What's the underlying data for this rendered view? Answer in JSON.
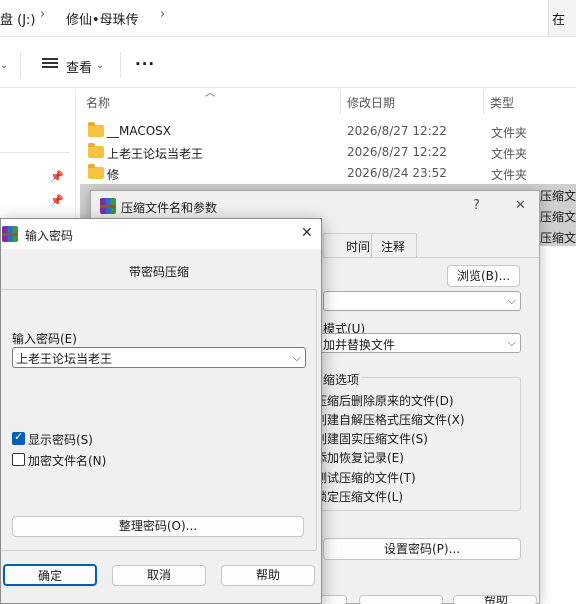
{
  "explorer": {
    "breadcrumb": {
      "drive": "盘 (J:)",
      "folder": "修仙•母珠传",
      "right_cut": "在"
    },
    "toolbar": {
      "view": "查看",
      "more": "···"
    },
    "columns": {
      "name": "名称",
      "modified": "修改日期",
      "type": "类型"
    },
    "rows": [
      {
        "name": "__MACOSX",
        "date": "2026/8/27 12:22",
        "type": "文件夹"
      },
      {
        "name": "上老王论坛当老王",
        "date": "2026/8/27 12:22",
        "type": "文件夹"
      },
      {
        "name": "修",
        "date": "2026/8/24 23:52",
        "type": "文件夹"
      }
    ],
    "selected_types": [
      "压缩文",
      "压缩文",
      "压缩文"
    ]
  },
  "rar_dialog": {
    "title": "压缩文件名和参数",
    "help": "?",
    "close": "✕",
    "tabs": [
      "时间",
      "注释"
    ],
    "browse": "浏览(B)...",
    "update_mode_label": "模式(U)",
    "update_mode_value": "加并替换文件",
    "options_group": "缩选项",
    "options": [
      "压缩后删除原来的文件(D)",
      "创建自解压格式压缩文件(X)",
      "创建固实压缩文件(S)",
      "添加恢复记录(E)",
      "测试压缩的文件(T)",
      "锁定压缩文件(L)"
    ],
    "set_password": "设置密码(P)...",
    "bottom_cut": "帮助"
  },
  "password_dialog": {
    "title": "输入密码",
    "close": "✕",
    "subtitle": "带密码压缩",
    "input_label": "输入密码(E)",
    "input_value": "上老王论坛当老王",
    "show_password": "显示密码(S)",
    "show_password_checked": true,
    "encrypt_names": "加密文件名(N)",
    "encrypt_names_checked": false,
    "organize": "整理密码(O)...",
    "ok": "确定",
    "cancel": "取消",
    "help": "帮助"
  }
}
